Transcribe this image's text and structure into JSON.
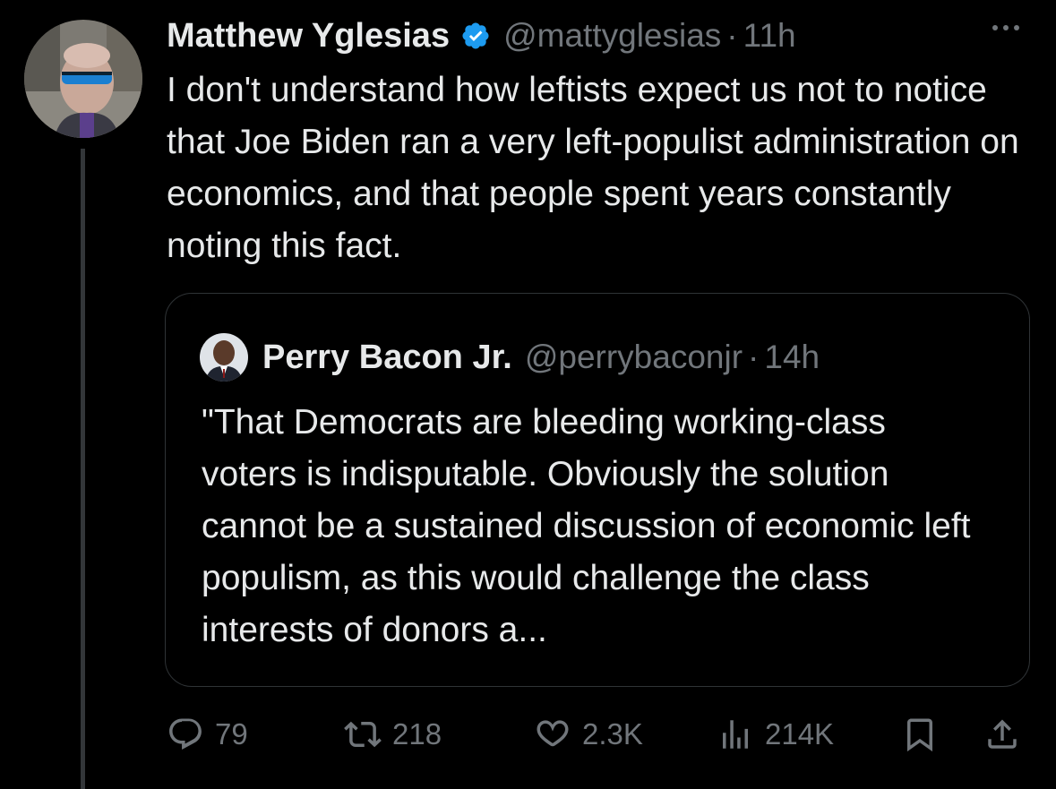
{
  "tweet": {
    "author_name": "Matthew Yglesias",
    "handle": "@mattyglesias",
    "separator": "·",
    "time": "11h",
    "text": "I don't understand how leftists expect us not to notice that Joe Biden ran a very left-populist administration on economics, and that people spent years constantly noting this fact."
  },
  "quote": {
    "author_name": "Perry Bacon Jr.",
    "handle": "@perrybaconjr",
    "separator": "·",
    "time": "14h",
    "text": "\"That Democrats are bleeding working-class voters is indisputable. Obviously the solution cannot be a sustained discussion of economic left populism, as this would challenge the class interests of donors a..."
  },
  "actions": {
    "replies": "79",
    "reposts": "218",
    "likes": "2.3K",
    "views": "214K"
  },
  "icons": {
    "verified": "verified-badge-icon",
    "more": "more-icon",
    "reply": "reply-icon",
    "repost": "repost-icon",
    "like": "heart-icon",
    "views": "views-icon",
    "bookmark": "bookmark-icon",
    "share": "share-icon"
  },
  "colors": {
    "background": "#000000",
    "text": "#e7e9ea",
    "secondary": "#71767b",
    "verified": "#1d9bf0",
    "border": "#2f3336"
  }
}
